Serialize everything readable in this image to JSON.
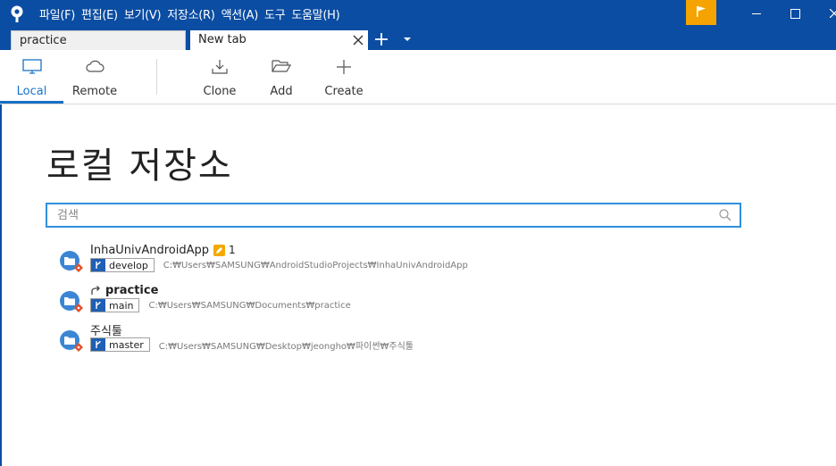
{
  "titlebar": {
    "menu": [
      "파일(F)",
      "편집(E)",
      "보기(V)",
      "저장소(R)",
      "액션(A)",
      "도구",
      "도움말(H)"
    ],
    "accent_color": "#0b4da2",
    "flag_color": "#f5a300",
    "icons": [
      "sourcetree-logo-icon",
      "flag-icon",
      "minimize-icon",
      "maximize-icon",
      "close-icon"
    ]
  },
  "tabs": [
    {
      "label": "practice",
      "active": false
    },
    {
      "label": "New tab",
      "active": true
    }
  ],
  "toolbar": {
    "local": "Local",
    "remote": "Remote",
    "clone": "Clone",
    "add": "Add",
    "create": "Create"
  },
  "main": {
    "title": "로컬 저장소",
    "search_placeholder": "검색"
  },
  "repos": [
    {
      "name": "InhaUnivAndroidApp",
      "changes": "1",
      "branch": "develop",
      "path": "C:₩Users₩SAMSUNG₩AndroidStudioProjects₩InhaUnivAndroidApp"
    },
    {
      "name": "practice",
      "branch": "main",
      "path": "C:₩Users₩SAMSUNG₩Documents₩practice"
    },
    {
      "name": "주식툴",
      "branch": "master",
      "path": "C:₩Users₩SAMSUNG₩Desktop₩jeongho₩파이썬₩주식툴"
    }
  ]
}
